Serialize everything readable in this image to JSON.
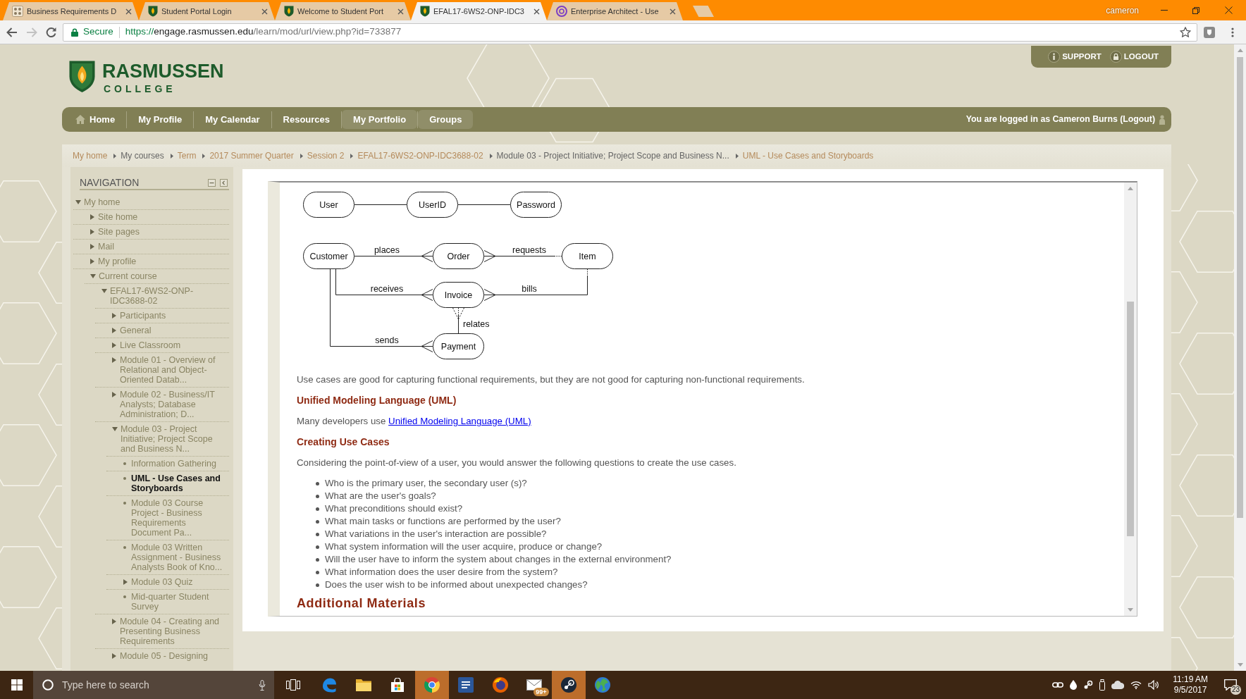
{
  "browser": {
    "tabs": [
      {
        "title": "Business Requirements D",
        "selected": false
      },
      {
        "title": "Student Portal Login",
        "selected": false
      },
      {
        "title": "Welcome to Student Port",
        "selected": false
      },
      {
        "title": "EFAL17-6WS2-ONP-IDC3",
        "selected": true
      },
      {
        "title": "Enterprise Architect - Use",
        "selected": false
      }
    ],
    "profile": "cameron",
    "can_go_forward": false,
    "security_label": "Secure",
    "url": {
      "scheme": "https://",
      "host": "engage.rasmussen.edu",
      "path": "/learn/mod/url/view.php?id=733877"
    }
  },
  "header": {
    "logo": {
      "name": "RASMUSSEN",
      "subtitle": "COLLEGE"
    },
    "top_links": [
      {
        "label": "SUPPORT"
      },
      {
        "label": "LOGOUT"
      }
    ]
  },
  "main_menu": {
    "items": [
      {
        "label": "Home",
        "highlighted": false
      },
      {
        "label": "My Profile",
        "highlighted": false
      },
      {
        "label": "My Calendar",
        "highlighted": false
      },
      {
        "label": "Resources",
        "highlighted": false
      },
      {
        "label": "My Portfolio",
        "highlighted": true
      },
      {
        "label": "Groups",
        "highlighted": true
      }
    ],
    "user_info": "You are logged in as Cameron Burns (Logout)"
  },
  "breadcrumb": [
    {
      "label": "My home",
      "link": true
    },
    {
      "label": "My courses",
      "link": false
    },
    {
      "label": "Term",
      "link": true
    },
    {
      "label": "2017 Summer Quarter",
      "link": true
    },
    {
      "label": "Session 2",
      "link": true
    },
    {
      "label": "EFAL17-6WS2-ONP-IDC3688-02",
      "link": true
    },
    {
      "label": "Module 03 - Project Initiative; Project Scope and Business N...",
      "link": false
    },
    {
      "label": "UML - Use Cases and Storyboards",
      "link": true
    }
  ],
  "sidebar": {
    "title": "NAVIGATION",
    "tree": [
      {
        "label": "My home",
        "kind": "branch",
        "expanded": true,
        "selected": false,
        "children": [
          {
            "label": "Site home",
            "kind": "branch",
            "expanded": false,
            "selected": false
          },
          {
            "label": "Site pages",
            "kind": "branch",
            "expanded": false,
            "selected": false
          },
          {
            "label": "Mail",
            "kind": "branch",
            "expanded": false,
            "selected": false
          },
          {
            "label": "My profile",
            "kind": "branch",
            "expanded": false,
            "selected": false
          },
          {
            "label": "Current course",
            "kind": "branch",
            "expanded": true,
            "selected": false,
            "children": [
              {
                "label": "EFAL17-6WS2-ONP-IDC3688-02",
                "kind": "branch",
                "expanded": true,
                "selected": false,
                "children": [
                  {
                    "label": "Participants",
                    "kind": "branch",
                    "expanded": false,
                    "selected": false
                  },
                  {
                    "label": "General",
                    "kind": "branch",
                    "expanded": false,
                    "selected": false
                  },
                  {
                    "label": "Live Classroom",
                    "kind": "branch",
                    "expanded": false,
                    "selected": false
                  },
                  {
                    "label": "Module 01 - Overview of Relational and Object-Oriented Datab...",
                    "kind": "branch",
                    "expanded": false,
                    "selected": false
                  },
                  {
                    "label": "Module 02 - Business/IT Analysts; Database Administration; D...",
                    "kind": "branch",
                    "expanded": false,
                    "selected": false
                  },
                  {
                    "label": "Module 03 - Project Initiative; Project Scope and Business N...",
                    "kind": "branch",
                    "expanded": true,
                    "selected": false,
                    "children": [
                      {
                        "label": "Information Gathering",
                        "kind": "leaf",
                        "selected": false
                      },
                      {
                        "label": "UML - Use Cases and Storyboards",
                        "kind": "leaf",
                        "selected": true
                      },
                      {
                        "label": "Module 03 Course Project - Business Requirements Document Pa...",
                        "kind": "leaf",
                        "selected": false
                      },
                      {
                        "label": "Module 03 Written Assignment - Business Analysts Book of Kno...",
                        "kind": "leaf",
                        "selected": false
                      },
                      {
                        "label": "Module 03 Quiz",
                        "kind": "branch",
                        "expanded": false,
                        "selected": false
                      },
                      {
                        "label": "Mid-quarter Student Survey",
                        "kind": "leaf",
                        "selected": false
                      }
                    ]
                  },
                  {
                    "label": "Module 04 - Creating and Presenting Business Requirements",
                    "kind": "branch",
                    "expanded": false,
                    "selected": false
                  },
                  {
                    "label": "Module 05 - Designing",
                    "kind": "branch",
                    "expanded": false,
                    "selected": false
                  }
                ]
              }
            ]
          }
        ]
      }
    ]
  },
  "content": {
    "diagram": {
      "entities": [
        {
          "label": "User"
        },
        {
          "label": "UserID"
        },
        {
          "label": "Password"
        },
        {
          "label": "Customer"
        },
        {
          "label": "Order"
        },
        {
          "label": "Item"
        },
        {
          "label": "Invoice"
        },
        {
          "label": "Payment"
        }
      ],
      "links": [
        {
          "kind": "plain"
        },
        {
          "kind": "plain"
        },
        {
          "label": "places",
          "kind": "crowfoot-end"
        },
        {
          "label": "requests",
          "kind": "crowfoot-start"
        },
        {
          "label": "receives",
          "kind": "crowfoot-end"
        },
        {
          "label": "bills",
          "kind": "crowfoot-start"
        },
        {
          "label": "relates",
          "kind": "dashed-crowfoot-start"
        },
        {
          "label": "sends",
          "kind": "crowfoot-end"
        }
      ]
    },
    "blocks": [
      {
        "kind": "paragraph",
        "text": "Use cases are good for capturing functional requirements, but they are not good for capturing non-functional requirements."
      },
      {
        "kind": "heading",
        "text": "Unified Modeling Language (UML)"
      },
      {
        "kind": "link_paragraph",
        "text": "Many developers use",
        "link": "Unified Modeling Language (UML)"
      },
      {
        "kind": "heading",
        "text": "Creating Use Cases"
      },
      {
        "kind": "paragraph",
        "text": "Considering the point-of-view of a user, you would answer the following questions to create the use cases."
      },
      {
        "kind": "list",
        "items": [
          "Who is the primary user, the secondary user (s)?",
          "What are the user's goals?",
          "What preconditions should exist?",
          "What main tasks or functions are performed by the user?",
          "What variations in the user's interaction are possible?",
          "What system information will the user acquire, produce or change?",
          "Will the user have to inform the system about changes in the external environment?",
          "What information does the user desire from the system?",
          "Does the user wish to be informed about unexpected changes?"
        ]
      },
      {
        "kind": "title",
        "text": "Additional Materials"
      }
    ]
  },
  "taskbar": {
    "search_placeholder": "Type here to search",
    "apps": [
      {
        "highlighted": false
      },
      {
        "highlighted": false
      },
      {
        "highlighted": false
      },
      {
        "highlighted": true
      },
      {
        "highlighted": false
      },
      {
        "highlighted": false
      },
      {
        "highlighted": false,
        "badge": "99+"
      },
      {
        "highlighted": true
      },
      {
        "highlighted": false
      }
    ],
    "clock": {
      "time": "11:19 AM",
      "date": "9/5/2017"
    },
    "notification_count": "23"
  }
}
